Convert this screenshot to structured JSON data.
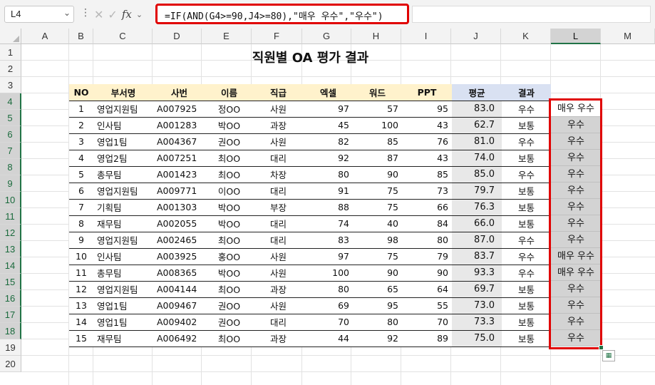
{
  "formula_bar": {
    "name_box": "L4",
    "fx": "fx",
    "formula": "=IF(AND(G4>=90,J4>=80),\"매우 우수\",\"우수\")"
  },
  "columns": [
    "A",
    "B",
    "C",
    "D",
    "E",
    "F",
    "G",
    "H",
    "I",
    "J",
    "K",
    "L",
    "M"
  ],
  "rows": [
    "1",
    "2",
    "3",
    "4",
    "5",
    "6",
    "7",
    "8",
    "9",
    "10",
    "11",
    "12",
    "13",
    "14",
    "15",
    "16",
    "17",
    "18",
    "19",
    "20"
  ],
  "sheet": {
    "title": "직원별 OA 평가 결과",
    "headers": [
      "NO",
      "부서명",
      "사번",
      "이름",
      "직급",
      "엑셀",
      "워드",
      "PPT",
      "평균",
      "결과"
    ],
    "records": [
      [
        "1",
        "영업지원팀",
        "A007925",
        "정OO",
        "사원",
        "97",
        "57",
        "95",
        "83.0",
        "우수",
        "매우 우수"
      ],
      [
        "2",
        "인사팀",
        "A001283",
        "박OO",
        "과장",
        "45",
        "100",
        "43",
        "62.7",
        "보통",
        "우수"
      ],
      [
        "3",
        "영업1팀",
        "A004367",
        "권OO",
        "사원",
        "82",
        "85",
        "76",
        "81.0",
        "우수",
        "우수"
      ],
      [
        "4",
        "영업2팀",
        "A007251",
        "최OO",
        "대리",
        "92",
        "87",
        "43",
        "74.0",
        "보통",
        "우수"
      ],
      [
        "5",
        "총무팀",
        "A001423",
        "최OO",
        "차장",
        "80",
        "90",
        "85",
        "85.0",
        "우수",
        "우수"
      ],
      [
        "6",
        "영업지원팀",
        "A009771",
        "이OO",
        "대리",
        "91",
        "75",
        "73",
        "79.7",
        "보통",
        "우수"
      ],
      [
        "7",
        "기획팀",
        "A001303",
        "박OO",
        "부장",
        "88",
        "75",
        "66",
        "76.3",
        "보통",
        "우수"
      ],
      [
        "8",
        "재무팀",
        "A002055",
        "박OO",
        "대리",
        "74",
        "40",
        "84",
        "66.0",
        "보통",
        "우수"
      ],
      [
        "9",
        "영업지원팀",
        "A002465",
        "최OO",
        "대리",
        "83",
        "98",
        "80",
        "87.0",
        "우수",
        "우수"
      ],
      [
        "10",
        "인사팀",
        "A003925",
        "홍OO",
        "사원",
        "97",
        "75",
        "79",
        "83.7",
        "우수",
        "매우 우수"
      ],
      [
        "11",
        "총무팀",
        "A008365",
        "박OO",
        "사원",
        "100",
        "90",
        "90",
        "93.3",
        "우수",
        "매우 우수"
      ],
      [
        "12",
        "영업지원팀",
        "A004144",
        "최OO",
        "과장",
        "80",
        "65",
        "64",
        "69.7",
        "보통",
        "우수"
      ],
      [
        "13",
        "영업1팀",
        "A009467",
        "권OO",
        "사원",
        "69",
        "95",
        "55",
        "73.0",
        "보통",
        "우수"
      ],
      [
        "14",
        "영업1팀",
        "A009402",
        "권OO",
        "대리",
        "70",
        "80",
        "70",
        "73.3",
        "보통",
        "우수"
      ],
      [
        "15",
        "재무팀",
        "A006492",
        "최OO",
        "과장",
        "44",
        "92",
        "89",
        "75.0",
        "보통",
        "우수"
      ]
    ]
  }
}
